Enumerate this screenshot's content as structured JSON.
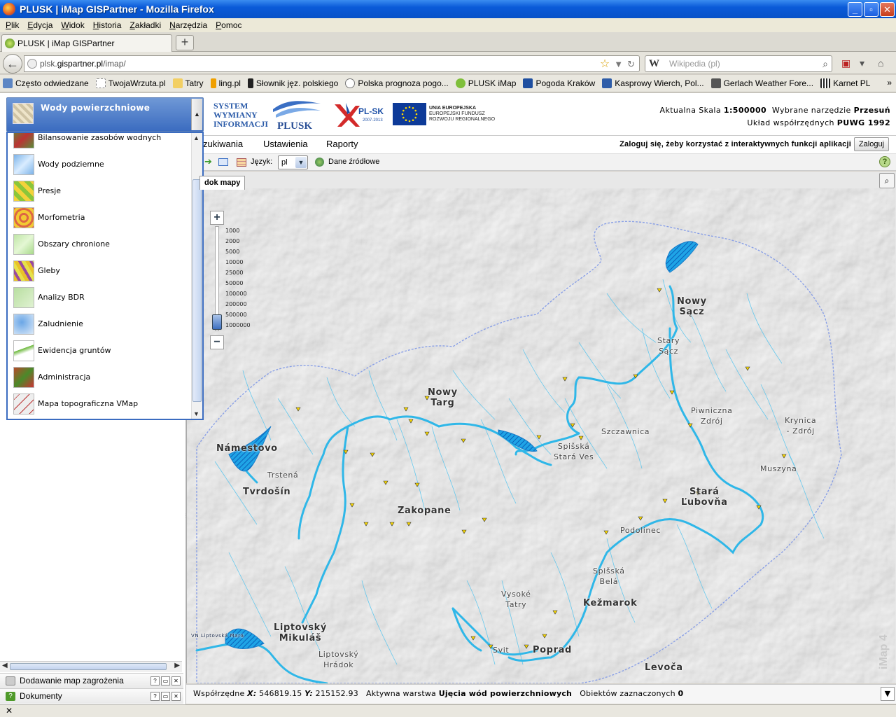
{
  "window": {
    "title": "PLUSK | iMap GISPartner - Mozilla Firefox"
  },
  "menubar": [
    "Plik",
    "Edycja",
    "Widok",
    "Historia",
    "Zakładki",
    "Narzędzia",
    "Pomoc"
  ],
  "tab": {
    "title": "PLUSK | iMap GISPartner",
    "new_tab": "+"
  },
  "nav": {
    "url_host": "plsk.",
    "url_domain": "gispartner.pl",
    "url_path": "/imap/",
    "search_placeholder": "Wikipedia (pl)",
    "search_engine": "W"
  },
  "bookmarks": [
    "Często odwiedzane",
    "TwojaWrzuta.pl",
    "Tatry",
    "ling.pl",
    "Słownik jęz. polskiego",
    "Polska prognoza pogo...",
    "PLUSK iMap",
    "Pogoda Kraków",
    "Kasprowy Wierch, Pol...",
    "Gerlach Weather Fore...",
    "Karnet PL"
  ],
  "header": {
    "system_line1": "SYSTEM",
    "system_line2": "WYMIANY",
    "system_line3": "INFORMACJI",
    "plusk": "PLUSK",
    "plsk": "PL-SK",
    "plsk_years": "2007-2013",
    "eu_line1": "UNIA EUROPEJSKA",
    "eu_line2": "EUROPEJSKI FUNDUSZ",
    "eu_line3": "ROZWOJU REGIONALNEGO",
    "scale_label": "Aktualna Skala",
    "scale_value": "1:500000",
    "tool_label": "Wybrane narzędzie",
    "tool_value": "Przesuń",
    "crs_label": "Układ współrzędnych",
    "crs_value": "PUWG 1992"
  },
  "appmenu": {
    "items": [
      "zukiwania",
      "Ustawienia",
      "Raporty"
    ],
    "login_msg": "Zaloguj się, żeby korzystać z interaktywnych funkcji aplikacji",
    "login_btn": "Zaloguj"
  },
  "toolbar": {
    "lang_label": "Język:",
    "lang_value": "pl",
    "sources": "Dane źródłowe",
    "help": "?"
  },
  "layer_combo": {
    "selected": "Wody powierzchniowe",
    "items": [
      "Bilansowanie zasobów wodnych",
      "Wody podziemne",
      "Presje",
      "Morfometria",
      "Obszary chronione",
      "Gleby",
      "Analizy BDR",
      "Zaludnienie",
      "Ewidencja gruntów",
      "Administracja",
      "Mapa topograficzna VMap"
    ]
  },
  "left_panel": {
    "rows": [
      {
        "label": "Dodawanie map zagrożenia"
      },
      {
        "label": "Dokumenty"
      }
    ]
  },
  "map": {
    "tab": "dok mapy",
    "zoom_in": "+",
    "zoom_out": "−",
    "scales": [
      "1000",
      "2000",
      "5000",
      "10000",
      "25000",
      "50000",
      "100000",
      "200000",
      "500000",
      "1000000"
    ],
    "labels": {
      "nowy_sacz_1": "Nowy",
      "nowy_sacz_2": "Sącz",
      "stary_sacz_1": "Stary",
      "stary_sacz_2": "Sącz",
      "nowy_targ_1": "Nowy",
      "nowy_targ_2": "Targ",
      "piwniczna_1": "Piwniczna",
      "piwniczna_2": "Zdrój",
      "krynica_1": "Krynica",
      "krynica_2": "- Zdrój",
      "szczawnica": "Szczawnica",
      "spisska_sv_1": "Spišská",
      "spisska_sv_2": "Stará Ves",
      "namestovo": "Námestovo",
      "trstena": "Trstená",
      "tvrdosin": "Tvrdošín",
      "zakopane": "Zakopane",
      "muszyna": "Muszyna",
      "lubovna_1": "Stará",
      "lubovna_2": "Ľubovňa",
      "podolinec": "Podolínec",
      "spisska_bela_1": "Spišská",
      "spisska_bela_2": "Belá",
      "vysoke_1": "Vysoké",
      "vysoke_2": "Tatry",
      "kezmarok": "Kežmarok",
      "liptov_mik_1": "Liptovský",
      "liptov_mik_2": "Mikuláš",
      "liptov_hr_1": "Liptovský",
      "liptov_hr_2": "Hrádok",
      "svit": "Svit",
      "poprad": "Poprad",
      "levoca": "Levoča",
      "vn": "VN Liptovská Mara"
    },
    "watermark": "iMap 4"
  },
  "statusbar": {
    "coords_label": "Współrzędne",
    "x_label": "X:",
    "x_value": "546819.15",
    "y_label": "Y:",
    "y_value": "215152.93",
    "active_label": "Aktywna warstwa",
    "active_value": "Ujęcia wód powierzchniowych",
    "selected_label": "Obiektów zaznaczonych",
    "selected_value": "0"
  },
  "browser_status": "✕",
  "colors": {
    "river": "#2fb7e8",
    "boundary": "#8aa0e6",
    "accent": "#3b6cc0"
  }
}
